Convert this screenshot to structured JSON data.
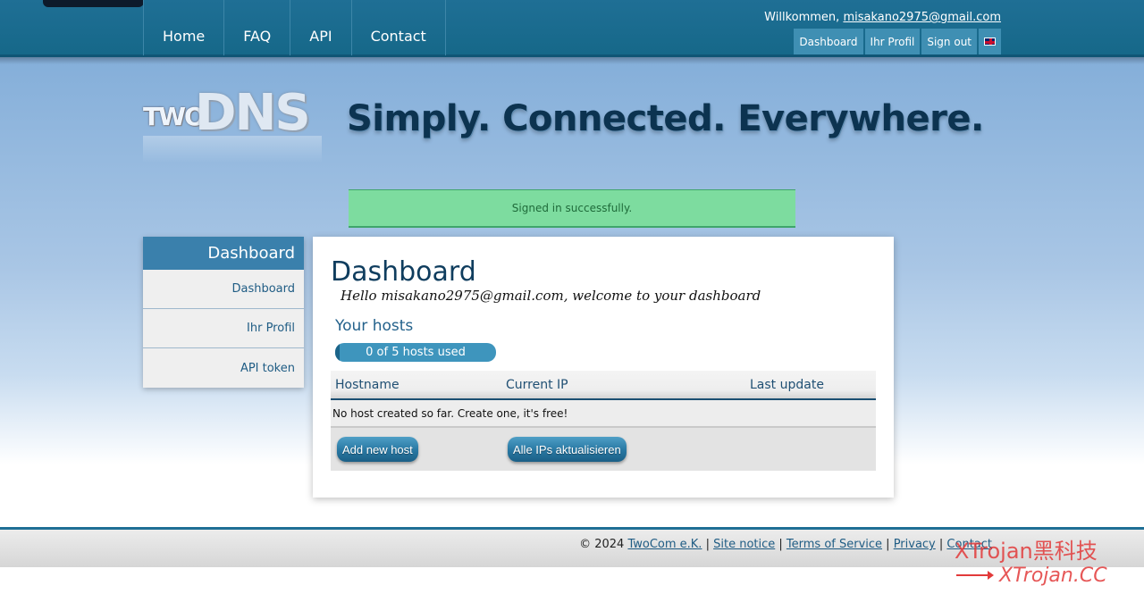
{
  "nav": {
    "items": [
      {
        "label": "Home"
      },
      {
        "label": "FAQ"
      },
      {
        "label": "API"
      },
      {
        "label": "Contact"
      }
    ]
  },
  "user": {
    "welcome_prefix": "Willkommen, ",
    "email": "misakano2975@gmail.com",
    "buttons": {
      "dashboard": "Dashboard",
      "profile": "Ihr Profil",
      "signout": "Sign out"
    },
    "language_flag": "uk-flag-icon"
  },
  "logo": {
    "two": "TWO",
    "dns": "DNS"
  },
  "slogan": "Simply. Connected. Everywhere.",
  "flash": "Signed in successfully.",
  "sidebar": {
    "title": "Dashboard",
    "items": [
      {
        "label": "Dashboard"
      },
      {
        "label": "Ihr Profil"
      },
      {
        "label": "API token"
      }
    ]
  },
  "main": {
    "title": "Dashboard",
    "hello": "Hello misakano2975@gmail.com, welcome to your dashboard",
    "hosts_title": "Your hosts",
    "progress_text": "0 of 5 hosts used",
    "progress_used": 0,
    "progress_total": 5,
    "table": {
      "columns": [
        "Hostname",
        "Current IP",
        "Last update"
      ],
      "empty_message": "No host created so far. Create one, it's free!"
    },
    "buttons": {
      "add_host": "Add new host",
      "update_all": "Alle IPs aktualisieren"
    }
  },
  "footer": {
    "copyright": "© 2024 ",
    "company": "TwoCom e.K.",
    "site_notice": "Site notice",
    "terms": "Terms of Service",
    "privacy": "Privacy",
    "contact": "Contact",
    "separator": " | "
  },
  "watermark": {
    "line1": "XTrojan黑科技",
    "line2": "XTrojan.CC"
  },
  "colors": {
    "brand": "#166889",
    "accent": "#3a80ac",
    "success": "#7ddc9f"
  }
}
